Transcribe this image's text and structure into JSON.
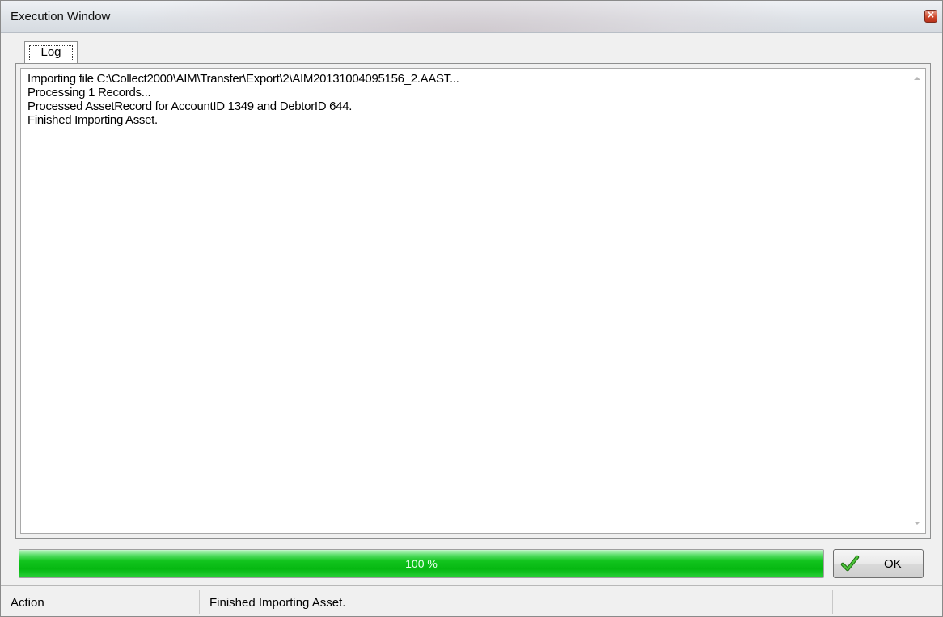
{
  "window": {
    "title": "Execution Window"
  },
  "tabs": [
    {
      "label": "Log",
      "selected": true
    }
  ],
  "log": {
    "lines": [
      "Importing file C:\\Collect2000\\AIM\\Transfer\\Export\\2\\AIM20131004095156_2.AAST...",
      "Processing 1 Records...",
      "Processed AssetRecord for AccountID 1349 and DebtorID 644.",
      "Finished Importing Asset."
    ]
  },
  "progress": {
    "value_percent": 100,
    "label": "100 %",
    "color": "#12c41e"
  },
  "buttons": {
    "ok_label": "OK"
  },
  "status": {
    "action_label": "Action",
    "message": "Finished Importing Asset.",
    "extra": ""
  },
  "icons": {
    "close": "close-icon",
    "ok": "checkmark-icon"
  },
  "colors": {
    "close_button": "#cf4a2e",
    "checkmark": "#2e9a1e"
  }
}
